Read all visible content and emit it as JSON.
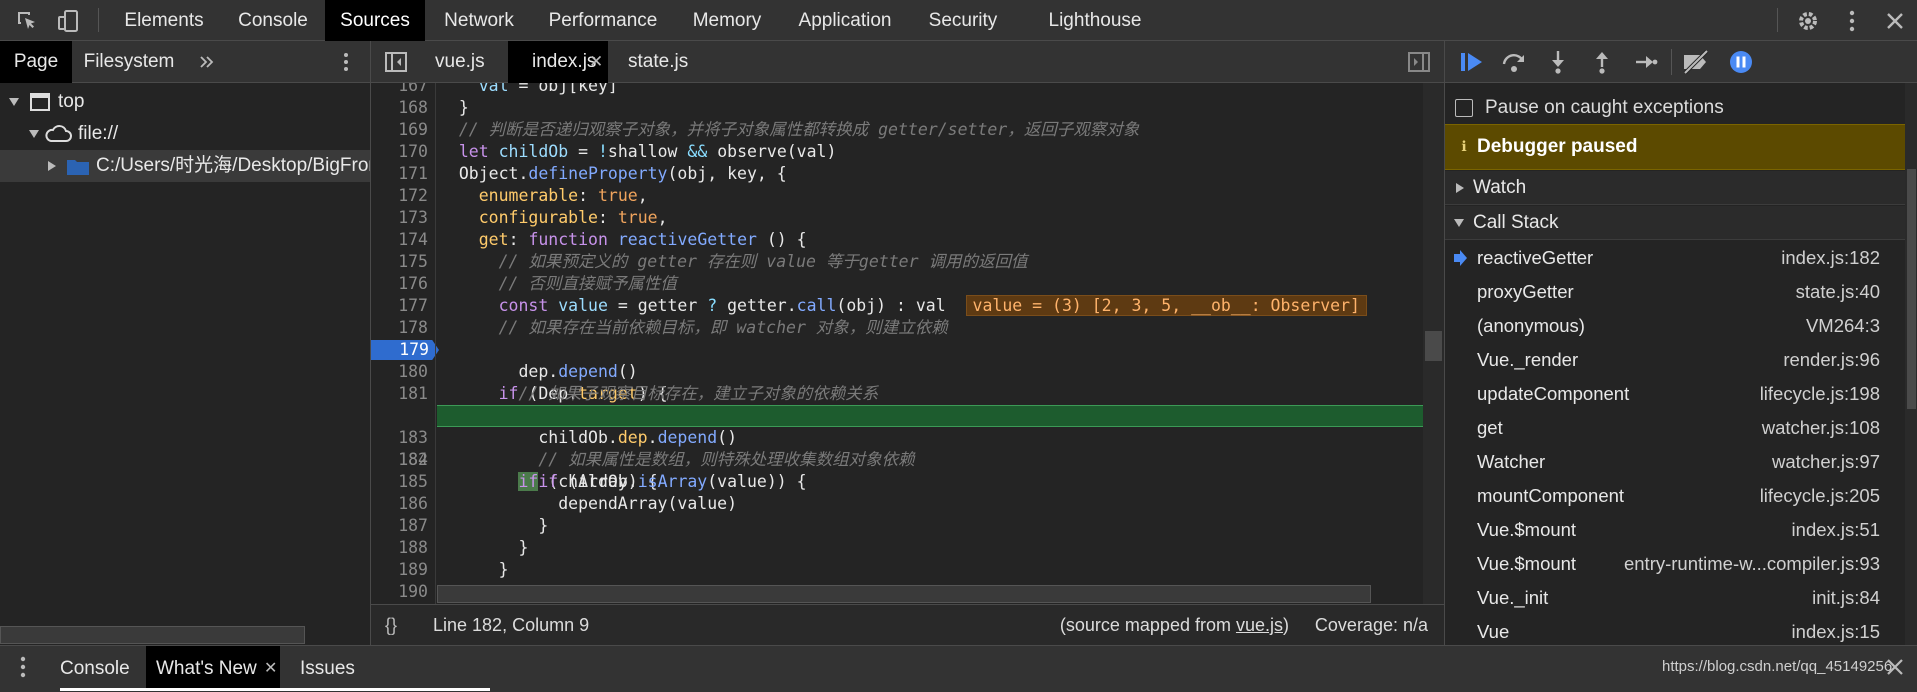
{
  "top_tabs": [
    "Elements",
    "Console",
    "Sources",
    "Network",
    "Performance",
    "Memory",
    "Application",
    "Security",
    "Lighthouse"
  ],
  "navigator": {
    "tabs": [
      "Page",
      "Filesystem"
    ],
    "tree": {
      "top": "top",
      "origin": "file://",
      "folder": "C:/Users/时光海/Desktop/BigFror"
    }
  },
  "editor": {
    "tabs": [
      "vue.js",
      "index.js",
      "state.js"
    ],
    "active_tab": "index.js",
    "lines": [
      {
        "n": "167",
        "code": "    val = obj[key]"
      },
      {
        "n": "168",
        "code": "  }"
      },
      {
        "n": "169",
        "code": "  // 判断是否递归观察子对象，并将子对象属性都转换成 getter/setter，返回子观察对象"
      },
      {
        "n": "170",
        "code": "  let childOb = !shallow && observe(val)"
      },
      {
        "n": "171",
        "code": "  Object.defineProperty(obj, key, {"
      },
      {
        "n": "172",
        "code": "    enumerable: true,"
      },
      {
        "n": "173",
        "code": "    configurable: true,"
      },
      {
        "n": "174",
        "code": "    get: function reactiveGetter () {"
      },
      {
        "n": "175",
        "code": "      // 如果预定义的 getter 存在则 value 等于getter 调用的返回值"
      },
      {
        "n": "176",
        "code": "      // 否则直接赋予属性值"
      },
      {
        "n": "177",
        "code": "      const value = getter ? getter.call(obj) : val"
      },
      {
        "n": "178",
        "code": "      // 如果存在当前依赖目标，即 watcher 对象，则建立依赖"
      },
      {
        "n": "179",
        "code": "      if (Dep.target) {"
      },
      {
        "n": "180",
        "code": "        dep.depend()"
      },
      {
        "n": "181",
        "code": "        // 如果子观察目标存在，建立子对象的依赖关系"
      },
      {
        "n": "182",
        "code": "        if (childOb) {"
      },
      {
        "n": "183",
        "code": "          childOb.dep.depend()"
      },
      {
        "n": "184",
        "code": "          // 如果属性是数组，则特殊处理收集数组对象依赖"
      },
      {
        "n": "185",
        "code": "          if (Array.isArray(value)) {"
      },
      {
        "n": "186",
        "code": "            dependArray(value)"
      },
      {
        "n": "187",
        "code": "          }"
      },
      {
        "n": "188",
        "code": "        }"
      },
      {
        "n": "189",
        "code": "      }"
      },
      {
        "n": "190",
        "code": ""
      }
    ],
    "inline_value": "value = (3) [2, 3, 5, __ob__: Observer]",
    "breakpoint_line": "179",
    "exec_line": "182",
    "status": {
      "braces": "{}",
      "position": "Line 182, Column 9",
      "source_mapped_prefix": "(source mapped from ",
      "source_mapped_file": "vue.js",
      "source_mapped_suffix": ")",
      "coverage": "Coverage: n/a"
    }
  },
  "debugger": {
    "pause_on_caught": "Pause on caught exceptions",
    "paused_banner": "Debugger paused",
    "watch": "Watch",
    "call_stack": "Call Stack",
    "frames": [
      {
        "name": "reactiveGetter",
        "loc": "index.js:182"
      },
      {
        "name": "proxyGetter",
        "loc": "state.js:40"
      },
      {
        "name": "(anonymous)",
        "loc": "VM264:3"
      },
      {
        "name": "Vue._render",
        "loc": "render.js:96"
      },
      {
        "name": "updateComponent",
        "loc": "lifecycle.js:198"
      },
      {
        "name": "get",
        "loc": "watcher.js:108"
      },
      {
        "name": "Watcher",
        "loc": "watcher.js:97"
      },
      {
        "name": "mountComponent",
        "loc": "lifecycle.js:205"
      },
      {
        "name": "Vue.$mount",
        "loc": "index.js:51"
      },
      {
        "name": "Vue.$mount",
        "loc": "entry-runtime-w...compiler.js:93"
      },
      {
        "name": "Vue._init",
        "loc": "init.js:84"
      },
      {
        "name": "Vue",
        "loc": "index.js:15"
      }
    ]
  },
  "drawer": {
    "tabs": [
      "Console",
      "What's New",
      "Issues"
    ],
    "watermark": "https://blog.csdn.net/qq_45149256"
  },
  "colors": {
    "paused_banner_bg": "#5c4a00",
    "exec_line_bg": "#1d5c2e",
    "breakpoint": "#2f6ccf",
    "accent": "#4a8af4"
  }
}
